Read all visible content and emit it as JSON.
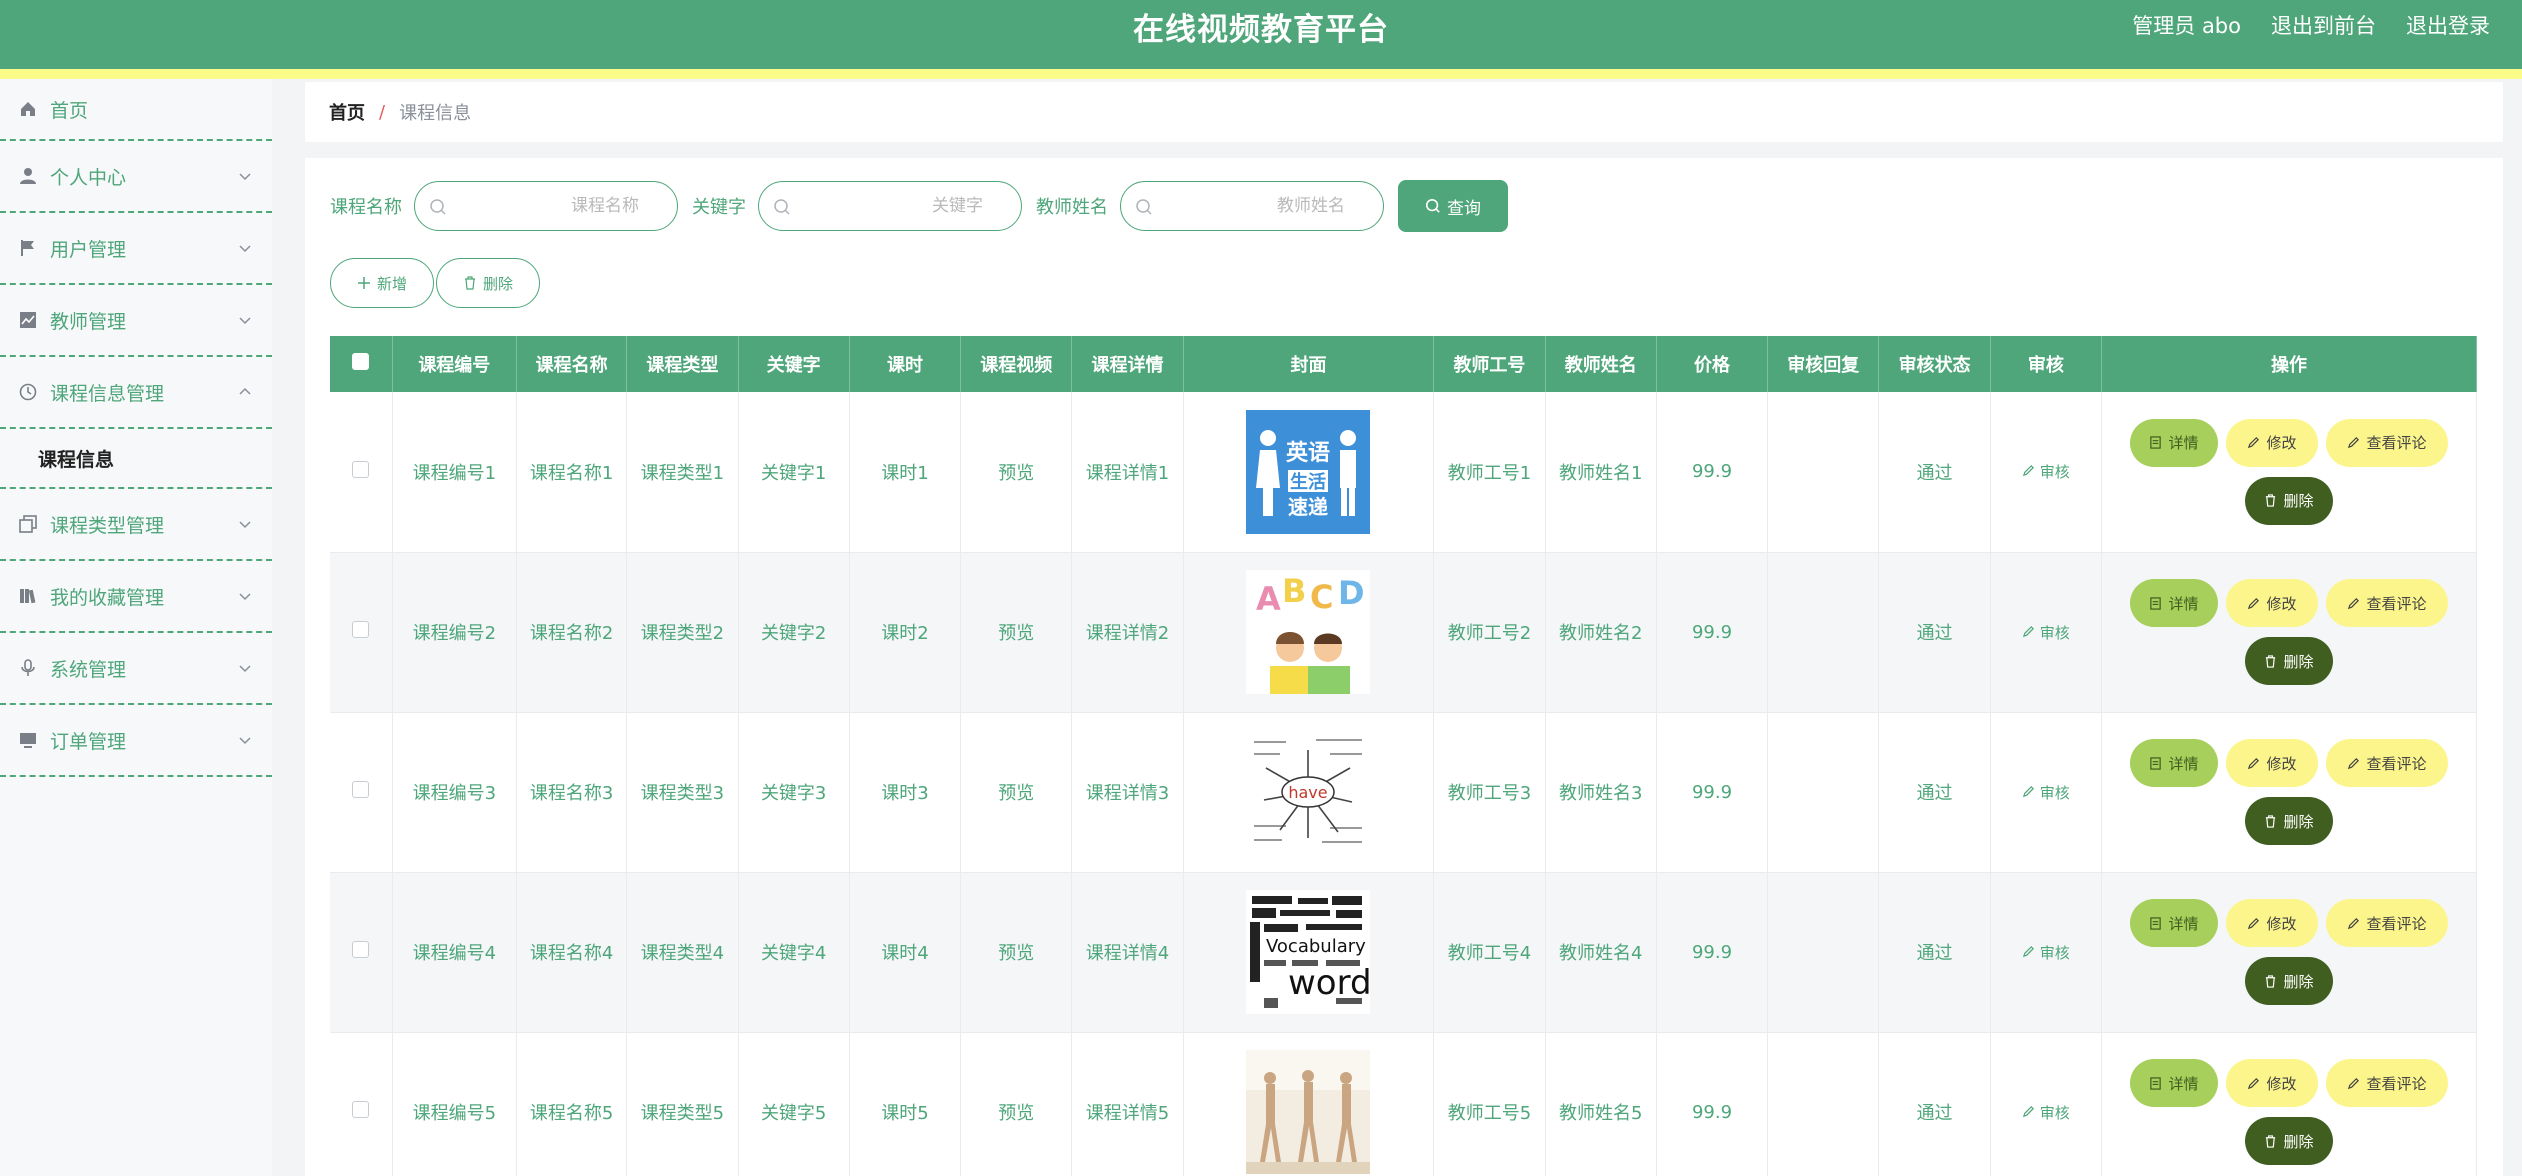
{
  "header": {
    "title": "在线视频教育平台",
    "links": [
      "管理员 abo",
      "退出到前台",
      "退出登录"
    ]
  },
  "sidebar": {
    "items": [
      {
        "label": "首页",
        "icon": "home-icon"
      },
      {
        "label": "个人中心",
        "icon": "user-icon"
      },
      {
        "label": "用户管理",
        "icon": "flag-icon"
      },
      {
        "label": "教师管理",
        "icon": "chart-icon"
      },
      {
        "label": "课程信息管理",
        "icon": "clock-icon"
      },
      {
        "label": "课程类型管理",
        "icon": "copy-icon"
      },
      {
        "label": "我的收藏管理",
        "icon": "books-icon"
      },
      {
        "label": "系统管理",
        "icon": "mic-icon"
      },
      {
        "label": "订单管理",
        "icon": "monitor-icon"
      }
    ],
    "submenu": "课程信息"
  },
  "breadcrumb": {
    "home": "首页",
    "separator": "/",
    "current": "课程信息"
  },
  "search": {
    "fields": [
      {
        "label": "课程名称",
        "placeholder": "课程名称"
      },
      {
        "label": "关键字",
        "placeholder": "关键字"
      },
      {
        "label": "教师姓名",
        "placeholder": "教师姓名"
      }
    ],
    "query_label": "查询"
  },
  "actions": {
    "add_label": "新增",
    "delete_label": "删除"
  },
  "table": {
    "headers": [
      "课程编号",
      "课程名称",
      "课程类型",
      "关键字",
      "课时",
      "课程视频",
      "课程详情",
      "封面",
      "教师工号",
      "教师姓名",
      "价格",
      "审核回复",
      "审核状态",
      "审核",
      "操作"
    ],
    "rows": [
      {
        "id": "课程编号1",
        "name": "课程名称1",
        "type": "课程类型1",
        "keyword": "关键字1",
        "hours": "课时1",
        "video": "预览",
        "detail": "课程详情1",
        "teacher_no": "教师工号1",
        "teacher_name": "教师姓名1",
        "price": "99.9",
        "reply": "",
        "status": "通过",
        "audit": "审核"
      },
      {
        "id": "课程编号2",
        "name": "课程名称2",
        "type": "课程类型2",
        "keyword": "关键字2",
        "hours": "课时2",
        "video": "预览",
        "detail": "课程详情2",
        "teacher_no": "教师工号2",
        "teacher_name": "教师姓名2",
        "price": "99.9",
        "reply": "",
        "status": "通过",
        "audit": "审核"
      },
      {
        "id": "课程编号3",
        "name": "课程名称3",
        "type": "课程类型3",
        "keyword": "关键字3",
        "hours": "课时3",
        "video": "预览",
        "detail": "课程详情3",
        "teacher_no": "教师工号3",
        "teacher_name": "教师姓名3",
        "price": "99.9",
        "reply": "",
        "status": "通过",
        "audit": "审核"
      },
      {
        "id": "课程编号4",
        "name": "课程名称4",
        "type": "课程类型4",
        "keyword": "关键字4",
        "hours": "课时4",
        "video": "预览",
        "detail": "课程详情4",
        "teacher_no": "教师工号4",
        "teacher_name": "教师姓名4",
        "price": "99.9",
        "reply": "",
        "status": "通过",
        "audit": "审核"
      },
      {
        "id": "课程编号5",
        "name": "课程名称5",
        "type": "课程类型5",
        "keyword": "关键字5",
        "hours": "课时5",
        "video": "预览",
        "detail": "课程详情5",
        "teacher_no": "教师工号5",
        "teacher_name": "教师姓名5",
        "price": "99.9",
        "reply": "",
        "status": "通过",
        "audit": "审核"
      }
    ],
    "row_actions": {
      "detail": "详情",
      "edit": "修改",
      "comments": "查看评论",
      "delete": "删除"
    },
    "cover_text": {
      "english_sign": [
        "英语",
        "生活",
        "速递"
      ],
      "abcd": [
        "A",
        "B",
        "C",
        "D"
      ],
      "have": "have",
      "vocab": [
        "Vocabulary",
        "words"
      ]
    }
  },
  "colors": {
    "primary": "#4ea67a",
    "accent_strip": "#fbfb8a",
    "detail_btn": "#a6cf5b",
    "edit_btn": "#fbf58b",
    "delete_btn": "#3f5e1f"
  }
}
